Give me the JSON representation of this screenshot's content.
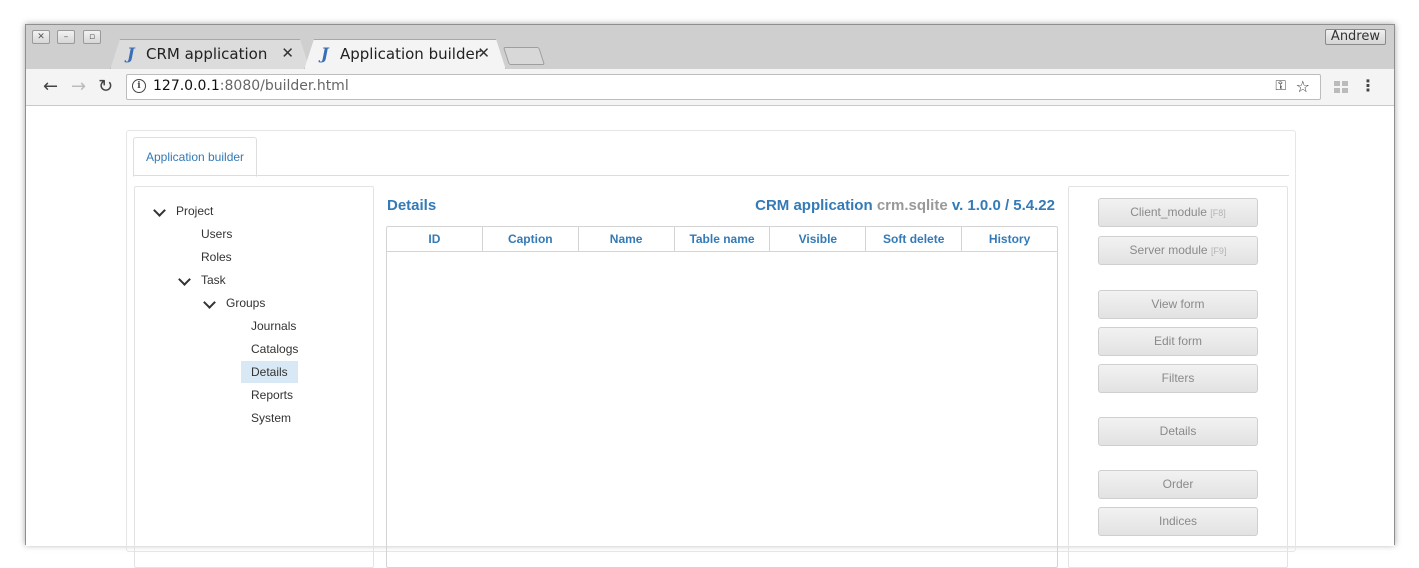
{
  "browser": {
    "tabs": [
      {
        "icon": "J",
        "title": "CRM application",
        "close": "✕"
      },
      {
        "icon": "J",
        "title": "Application builder",
        "close": "✕"
      }
    ],
    "user": "Andrew",
    "url_host": "127.0.0.1",
    "url_rest": ":8080/builder.html"
  },
  "app": {
    "tab_label": "Application builder",
    "tree": {
      "project": "Project",
      "users": "Users",
      "roles": "Roles",
      "task": "Task",
      "groups": "Groups",
      "journals": "Journals",
      "catalogs": "Catalogs",
      "details": "Details",
      "reports": "Reports",
      "system": "System",
      "selected": "Details"
    },
    "details": {
      "title": "Details",
      "project_name": "CRM application",
      "db_name": "crm.sqlite",
      "version": "v. 1.0.0 / 5.4.22",
      "columns": [
        "ID",
        "Caption",
        "Name",
        "Table name",
        "Visible",
        "Soft delete",
        "History"
      ]
    },
    "buttons": {
      "client_module": "Client_module",
      "client_hotkey": "[F8]",
      "server_module": "Server module",
      "server_hotkey": "[F9]",
      "view_form": "View form",
      "edit_form": "Edit form",
      "filters": "Filters",
      "details": "Details",
      "order": "Order",
      "indices": "Indices"
    }
  },
  "colors": {
    "accent": "#337ab7",
    "muted_text": "#999999",
    "selected_bg": "#d8e9f5"
  }
}
